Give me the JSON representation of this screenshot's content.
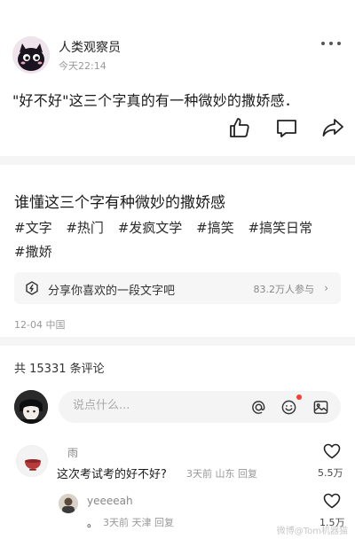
{
  "post": {
    "author": "人类观察员",
    "time": "今天22:14",
    "text": "\"好不好\"这三个字真的有一种微妙的撒娇感．",
    "more_icon": "more-dots-icon",
    "actions": {
      "like_icon": "thumbs-up-icon",
      "comment_icon": "comment-icon",
      "share_icon": "share-arrow-icon"
    }
  },
  "topic": {
    "title": "谁懂这三个字有种微妙的撒娇感",
    "tags": [
      "#文字",
      "#热门",
      "#发疯文学",
      "#搞笑",
      "#搞笑日常",
      "#撒娇"
    ]
  },
  "share_card": {
    "label": "分享你喜欢的一段文字吧",
    "count": "83.2万人参与",
    "chevron": "›"
  },
  "date_location": "12-04 中国",
  "comments": {
    "total_label": "共 15331 条评论",
    "input_placeholder": "说点什么...",
    "items": [
      {
        "name": "雨",
        "text": "这次考试考的好不好?",
        "meta": "3天前 山东 回复",
        "likes": "5.5万"
      },
      {
        "name": "yeeeeah",
        "text": "。",
        "meta": "3天前 天津 回复",
        "likes": "1.5万"
      }
    ]
  },
  "watermark": "微博@Tom机器猫",
  "colors": {
    "notify_dot": "#ff3b30",
    "card_bg": "#f6f6f6",
    "divider": "#f5f5f5"
  }
}
